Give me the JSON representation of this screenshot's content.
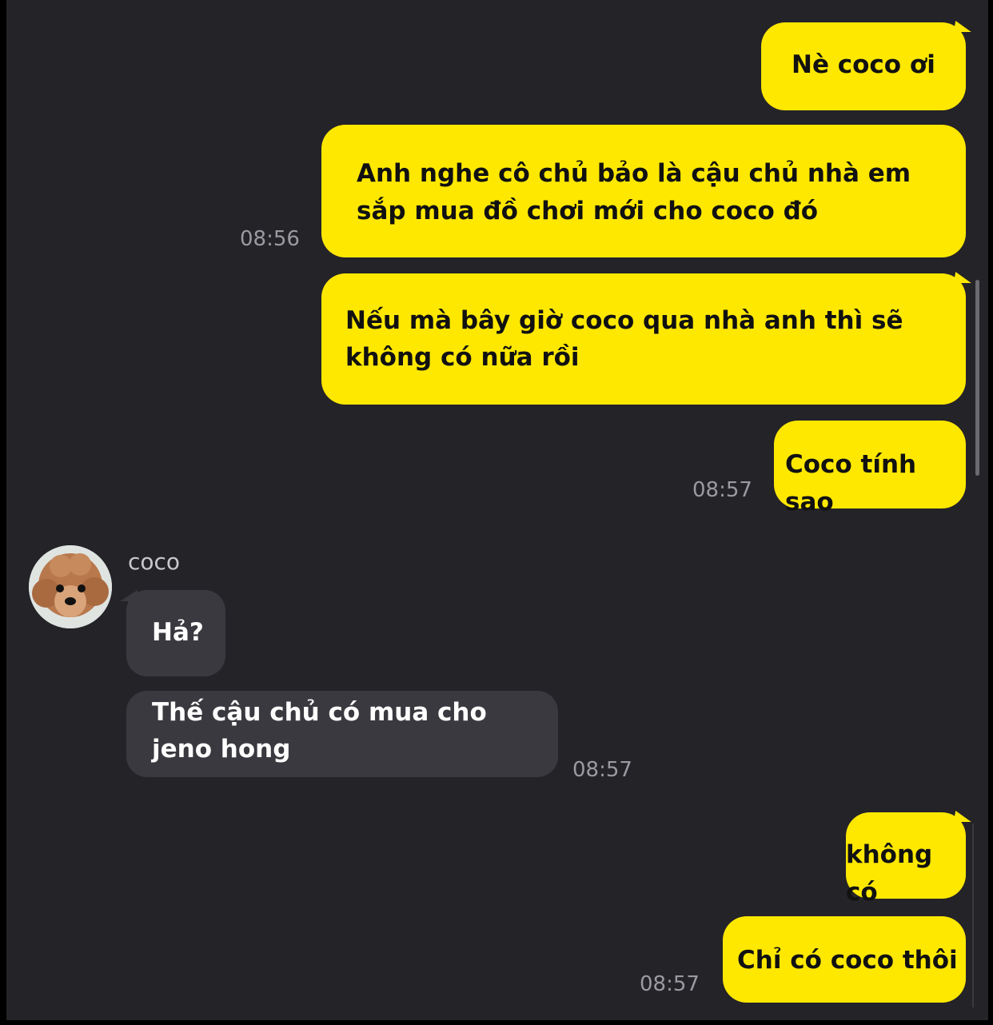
{
  "messages": [
    {
      "text": "Nè coco ơi"
    },
    {
      "text": "Anh nghe cô chủ bảo là cậu chủ nhà em sắp mua đồ chơi mới cho coco đó",
      "time": "08:56"
    },
    {
      "text": "Nếu mà bây giờ coco qua nhà anh thì sẽ không có nữa rồi"
    },
    {
      "text": "Coco tính sao",
      "time": "08:57"
    },
    {
      "sender": "coco",
      "text": "Hả?"
    },
    {
      "text": "Thế cậu chủ có mua cho jeno hong",
      "time": "08:57"
    },
    {
      "text": "không có"
    },
    {
      "text": "Chỉ có coco thôi",
      "time": "08:57"
    }
  ],
  "colors": {
    "background": "#242328",
    "outgoing_bubble": "#FFE800",
    "incoming_bubble": "#3a393f"
  },
  "icons": {
    "avatar": "poodle-avatar-icon"
  }
}
